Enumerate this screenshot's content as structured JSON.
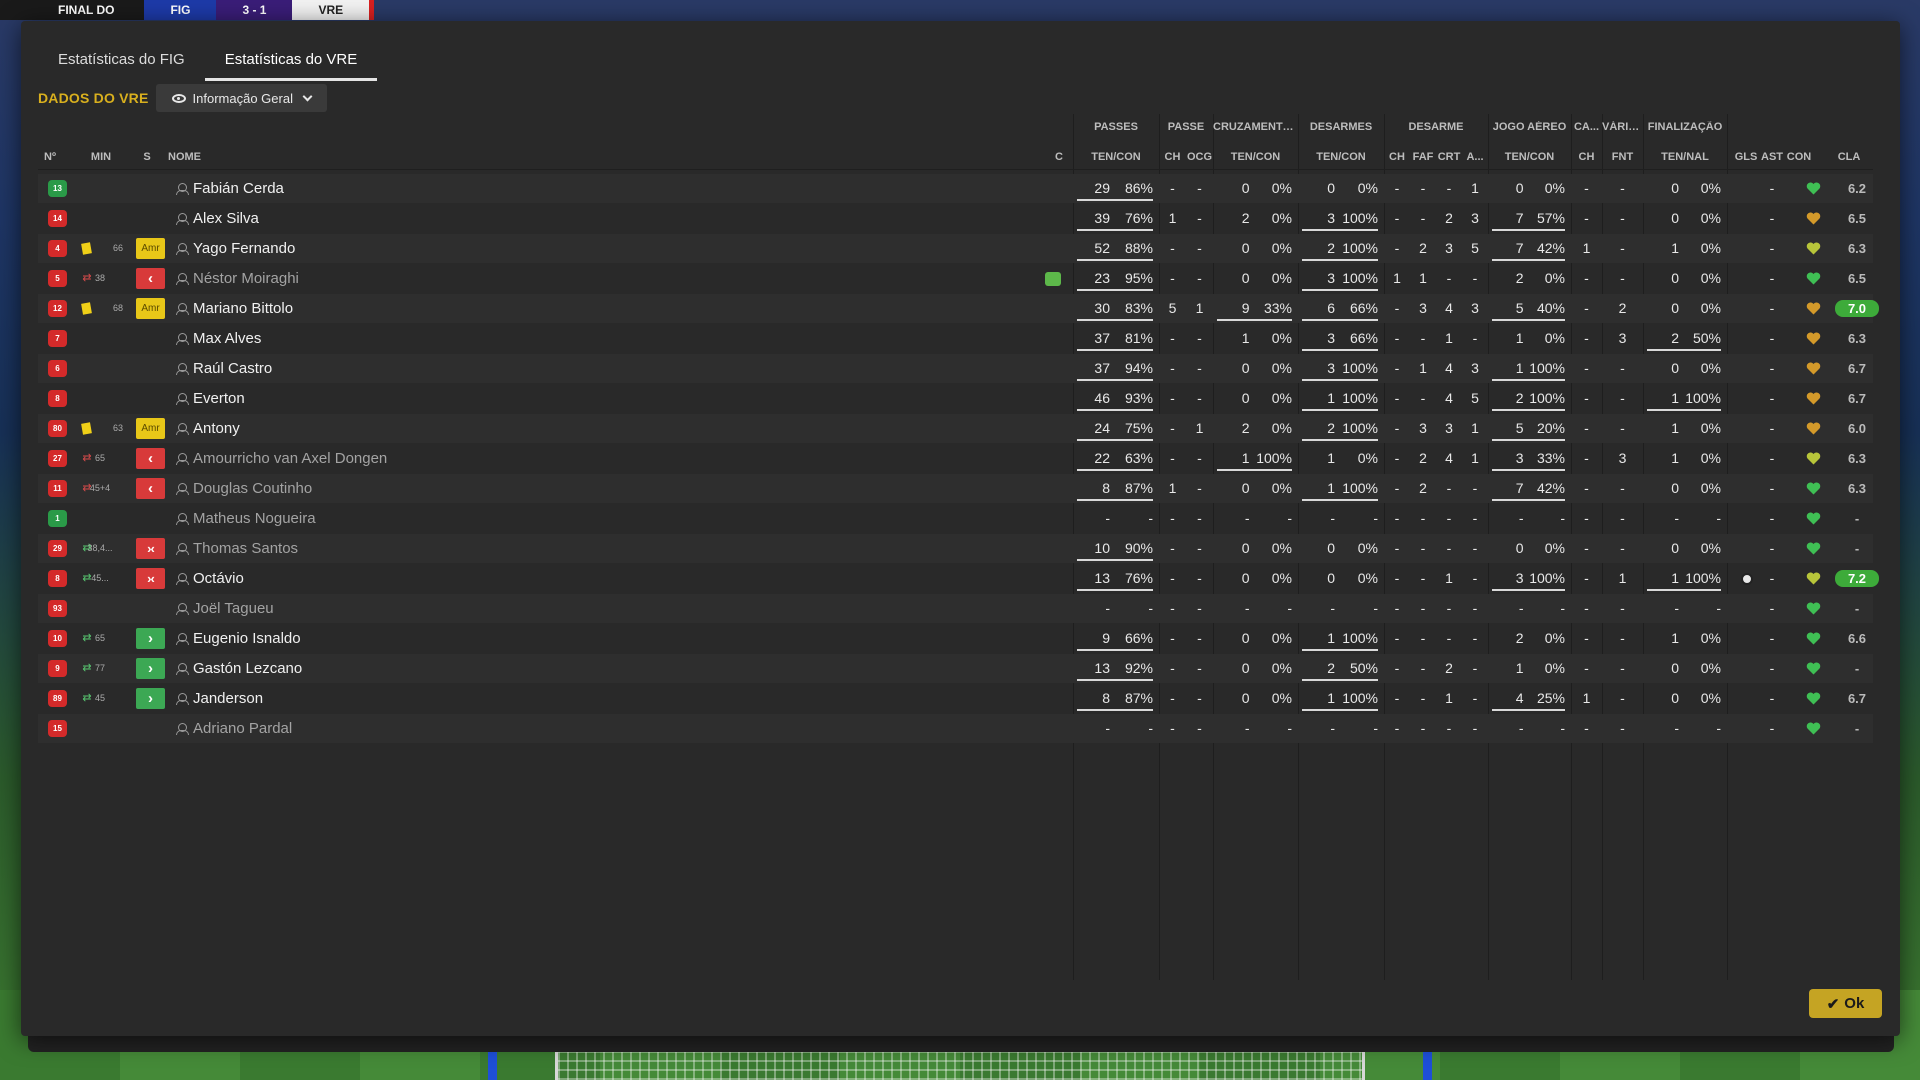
{
  "header": {
    "final_label": "FINAL DO",
    "home_abbr": "FIG",
    "score": "3 - 1",
    "away_abbr": "VRE"
  },
  "tabs": [
    {
      "label": "Estatísticas do FIG",
      "active": false
    },
    {
      "label": "Estatísticas do VRE",
      "active": true
    }
  ],
  "team_title": "DADOS DO VRE",
  "view_dropdown": {
    "selected": "Informação Geral"
  },
  "ok_label": "Ok",
  "colors": {
    "accent": "#d9b01e",
    "ok_button": "#c5a423",
    "card_yellow": "#f0d018",
    "rating_high": "#3dab3a",
    "shirt": "#d42a2a",
    "shirt_gk": "#2a9a48"
  },
  "column_groups": [
    {
      "label": "PASSES"
    },
    {
      "label": "PASSE"
    },
    {
      "label": "CRUZAMENTOS"
    },
    {
      "label": "DESARMES"
    },
    {
      "label": "DESARME"
    },
    {
      "label": "JOGO AÉREO"
    },
    {
      "label": "CA..."
    },
    {
      "label": "VÁRIOS"
    },
    {
      "label": "FINALIZAÇÃO"
    }
  ],
  "columns": {
    "num": "Nº",
    "min": "MIN",
    "s": "S",
    "name": "NOME",
    "c": "C",
    "pass": "TEN/CON",
    "pass_ch": "CH",
    "pass_ocg": "OCG",
    "cross": "TEN/CON",
    "tackles": "TEN/CON",
    "des_ch": "CH",
    "des_faf": "FAF",
    "des_crt": "CRT",
    "des_a": "A...",
    "aerial": "TEN/CON",
    "ca_ch": "CH",
    "fnt": "FNT",
    "fin": "TEN/NAL",
    "gls": "GLS",
    "ast": "AST",
    "con": "CON",
    "cla": "CLA"
  },
  "players": [
    {
      "num": "13",
      "gk": true,
      "card": false,
      "sub": "",
      "min": "",
      "status": "",
      "name": "Fabián Cerda",
      "dim": false,
      "inj": false,
      "pass": [
        "29",
        "86%"
      ],
      "pass_ul": true,
      "pch": "-",
      "pocg": "-",
      "cross": [
        "0",
        "0%"
      ],
      "cross_ul": false,
      "tack": [
        "0",
        "0%"
      ],
      "tack_ul": false,
      "dch": "-",
      "faf": "-",
      "crt": "-",
      "da": "1",
      "aer": [
        "0",
        "0%"
      ],
      "aer_ul": false,
      "cach": "-",
      "fnt": "-",
      "fin": [
        "0",
        "0%"
      ],
      "fin_ul": false,
      "goal": false,
      "gls": "",
      "ast": "-",
      "con": "green",
      "cla": "6.2",
      "cla_hl": false
    },
    {
      "num": "14",
      "gk": false,
      "card": false,
      "sub": "",
      "min": "",
      "status": "",
      "name": "Alex Silva",
      "dim": false,
      "inj": false,
      "pass": [
        "39",
        "76%"
      ],
      "pass_ul": true,
      "pch": "1",
      "pocg": "-",
      "cross": [
        "2",
        "0%"
      ],
      "cross_ul": false,
      "tack": [
        "3",
        "100%"
      ],
      "tack_ul": true,
      "dch": "-",
      "faf": "-",
      "crt": "2",
      "da": "3",
      "aer": [
        "7",
        "57%"
      ],
      "aer_ul": true,
      "cach": "-",
      "fnt": "-",
      "fin": [
        "0",
        "0%"
      ],
      "fin_ul": false,
      "goal": false,
      "gls": "",
      "ast": "-",
      "con": "orange",
      "cla": "6.5",
      "cla_hl": false
    },
    {
      "num": "4",
      "gk": false,
      "card": true,
      "sub": "",
      "min": "66",
      "status": "amr",
      "name": "Yago Fernando",
      "dim": false,
      "inj": false,
      "pass": [
        "52",
        "88%"
      ],
      "pass_ul": true,
      "pch": "-",
      "pocg": "-",
      "cross": [
        "0",
        "0%"
      ],
      "cross_ul": false,
      "tack": [
        "2",
        "100%"
      ],
      "tack_ul": true,
      "dch": "-",
      "faf": "2",
      "crt": "3",
      "da": "5",
      "aer": [
        "7",
        "42%"
      ],
      "aer_ul": true,
      "cach": "1",
      "fnt": "-",
      "fin": [
        "1",
        "0%"
      ],
      "fin_ul": false,
      "goal": false,
      "gls": "",
      "ast": "-",
      "con": "yellow",
      "cla": "6.3",
      "cla_hl": false
    },
    {
      "num": "5",
      "gk": false,
      "card": false,
      "sub": "out",
      "min": "38",
      "status": "out",
      "name": "Néstor Moiraghi",
      "dim": true,
      "inj": true,
      "pass": [
        "23",
        "95%"
      ],
      "pass_ul": true,
      "pch": "-",
      "pocg": "-",
      "cross": [
        "0",
        "0%"
      ],
      "cross_ul": false,
      "tack": [
        "3",
        "100%"
      ],
      "tack_ul": true,
      "dch": "1",
      "faf": "1",
      "crt": "-",
      "da": "-",
      "aer": [
        "2",
        "0%"
      ],
      "aer_ul": false,
      "cach": "-",
      "fnt": "-",
      "fin": [
        "0",
        "0%"
      ],
      "fin_ul": false,
      "goal": false,
      "gls": "",
      "ast": "-",
      "con": "green",
      "cla": "6.5",
      "cla_hl": false
    },
    {
      "num": "12",
      "gk": false,
      "card": true,
      "sub": "",
      "min": "68",
      "status": "amr",
      "name": "Mariano Bittolo",
      "dim": false,
      "inj": false,
      "pass": [
        "30",
        "83%"
      ],
      "pass_ul": true,
      "pch": "5",
      "pocg": "1",
      "cross": [
        "9",
        "33%"
      ],
      "cross_ul": true,
      "tack": [
        "6",
        "66%"
      ],
      "tack_ul": true,
      "dch": "-",
      "faf": "3",
      "crt": "4",
      "da": "3",
      "aer": [
        "5",
        "40%"
      ],
      "aer_ul": true,
      "cach": "-",
      "fnt": "2",
      "fin": [
        "0",
        "0%"
      ],
      "fin_ul": false,
      "goal": false,
      "gls": "",
      "ast": "-",
      "con": "orange",
      "cla": "7.0",
      "cla_hl": true
    },
    {
      "num": "7",
      "gk": false,
      "card": false,
      "sub": "",
      "min": "",
      "status": "",
      "name": "Max Alves",
      "dim": false,
      "inj": false,
      "pass": [
        "37",
        "81%"
      ],
      "pass_ul": true,
      "pch": "-",
      "pocg": "-",
      "cross": [
        "1",
        "0%"
      ],
      "cross_ul": false,
      "tack": [
        "3",
        "66%"
      ],
      "tack_ul": true,
      "dch": "-",
      "faf": "-",
      "crt": "1",
      "da": "-",
      "aer": [
        "1",
        "0%"
      ],
      "aer_ul": false,
      "cach": "-",
      "fnt": "3",
      "fin": [
        "2",
        "50%"
      ],
      "fin_ul": true,
      "goal": false,
      "gls": "",
      "ast": "-",
      "con": "orange",
      "cla": "6.3",
      "cla_hl": false
    },
    {
      "num": "6",
      "gk": false,
      "card": false,
      "sub": "",
      "min": "",
      "status": "",
      "name": "Raúl Castro",
      "dim": false,
      "inj": false,
      "pass": [
        "37",
        "94%"
      ],
      "pass_ul": true,
      "pch": "-",
      "pocg": "-",
      "cross": [
        "0",
        "0%"
      ],
      "cross_ul": false,
      "tack": [
        "3",
        "100%"
      ],
      "tack_ul": true,
      "dch": "-",
      "faf": "1",
      "crt": "4",
      "da": "3",
      "aer": [
        "1",
        "100%"
      ],
      "aer_ul": true,
      "cach": "-",
      "fnt": "-",
      "fin": [
        "0",
        "0%"
      ],
      "fin_ul": false,
      "goal": false,
      "gls": "",
      "ast": "-",
      "con": "orange",
      "cla": "6.7",
      "cla_hl": false
    },
    {
      "num": "8",
      "gk": false,
      "card": false,
      "sub": "",
      "min": "",
      "status": "",
      "name": "Everton",
      "dim": false,
      "inj": false,
      "pass": [
        "46",
        "93%"
      ],
      "pass_ul": true,
      "pch": "-",
      "pocg": "-",
      "cross": [
        "0",
        "0%"
      ],
      "cross_ul": false,
      "tack": [
        "1",
        "100%"
      ],
      "tack_ul": true,
      "dch": "-",
      "faf": "-",
      "crt": "4",
      "da": "5",
      "aer": [
        "2",
        "100%"
      ],
      "aer_ul": true,
      "cach": "-",
      "fnt": "-",
      "fin": [
        "1",
        "100%"
      ],
      "fin_ul": true,
      "goal": false,
      "gls": "",
      "ast": "-",
      "con": "orange",
      "cla": "6.7",
      "cla_hl": false
    },
    {
      "num": "80",
      "gk": false,
      "card": true,
      "sub": "",
      "min": "63",
      "status": "amr",
      "name": "Antony",
      "dim": false,
      "inj": false,
      "pass": [
        "24",
        "75%"
      ],
      "pass_ul": true,
      "pch": "-",
      "pocg": "1",
      "cross": [
        "2",
        "0%"
      ],
      "cross_ul": false,
      "tack": [
        "2",
        "100%"
      ],
      "tack_ul": true,
      "dch": "-",
      "faf": "3",
      "crt": "3",
      "da": "1",
      "aer": [
        "5",
        "20%"
      ],
      "aer_ul": true,
      "cach": "-",
      "fnt": "-",
      "fin": [
        "1",
        "0%"
      ],
      "fin_ul": false,
      "goal": false,
      "gls": "",
      "ast": "-",
      "con": "orange",
      "cla": "6.0",
      "cla_hl": false
    },
    {
      "num": "27",
      "gk": false,
      "card": false,
      "sub": "out",
      "min": "65",
      "status": "out",
      "name": "Amourricho van Axel Dongen",
      "dim": true,
      "inj": false,
      "pass": [
        "22",
        "63%"
      ],
      "pass_ul": true,
      "pch": "-",
      "pocg": "-",
      "cross": [
        "1",
        "100%"
      ],
      "cross_ul": true,
      "tack": [
        "1",
        "0%"
      ],
      "tack_ul": false,
      "dch": "-",
      "faf": "2",
      "crt": "4",
      "da": "1",
      "aer": [
        "3",
        "33%"
      ],
      "aer_ul": true,
      "cach": "-",
      "fnt": "3",
      "fin": [
        "1",
        "0%"
      ],
      "fin_ul": false,
      "goal": false,
      "gls": "",
      "ast": "-",
      "con": "yellow",
      "cla": "6.3",
      "cla_hl": false
    },
    {
      "num": "11",
      "gk": false,
      "card": false,
      "sub": "out",
      "min": "45+4",
      "status": "out",
      "name": "Douglas Coutinho",
      "dim": true,
      "inj": false,
      "pass": [
        "8",
        "87%"
      ],
      "pass_ul": true,
      "pch": "1",
      "pocg": "-",
      "cross": [
        "0",
        "0%"
      ],
      "cross_ul": false,
      "tack": [
        "1",
        "100%"
      ],
      "tack_ul": true,
      "dch": "-",
      "faf": "2",
      "crt": "-",
      "da": "-",
      "aer": [
        "7",
        "42%"
      ],
      "aer_ul": true,
      "cach": "-",
      "fnt": "-",
      "fin": [
        "0",
        "0%"
      ],
      "fin_ul": false,
      "goal": false,
      "gls": "",
      "ast": "-",
      "con": "green",
      "cla": "6.3",
      "cla_hl": false
    },
    {
      "num": "1",
      "gk": true,
      "card": false,
      "sub": "",
      "min": "",
      "status": "",
      "name": "Matheus Nogueira",
      "dim": true,
      "inj": false,
      "pass": [
        "-",
        "-"
      ],
      "pass_ul": false,
      "pch": "-",
      "pocg": "-",
      "cross": [
        "-",
        "-"
      ],
      "cross_ul": false,
      "tack": [
        "-",
        "-"
      ],
      "tack_ul": false,
      "dch": "-",
      "faf": "-",
      "crt": "-",
      "da": "-",
      "aer": [
        "-",
        "-"
      ],
      "aer_ul": false,
      "cach": "-",
      "fnt": "-",
      "fin": [
        "-",
        "-"
      ],
      "fin_ul": false,
      "goal": false,
      "gls": "",
      "ast": "-",
      "con": "green",
      "cla": "-",
      "cla_hl": false
    },
    {
      "num": "29",
      "gk": false,
      "card": false,
      "sub": "in",
      "min": "38,4...",
      "status": "inout",
      "name": "Thomas Santos",
      "dim": true,
      "inj": false,
      "pass": [
        "10",
        "90%"
      ],
      "pass_ul": true,
      "pch": "-",
      "pocg": "-",
      "cross": [
        "0",
        "0%"
      ],
      "cross_ul": false,
      "tack": [
        "0",
        "0%"
      ],
      "tack_ul": false,
      "dch": "-",
      "faf": "-",
      "crt": "-",
      "da": "-",
      "aer": [
        "0",
        "0%"
      ],
      "aer_ul": false,
      "cach": "-",
      "fnt": "-",
      "fin": [
        "0",
        "0%"
      ],
      "fin_ul": false,
      "goal": false,
      "gls": "",
      "ast": "-",
      "con": "green",
      "cla": "-",
      "cla_hl": false
    },
    {
      "num": "8",
      "gk": false,
      "card": false,
      "sub": "in",
      "min": "45...",
      "status": "inout",
      "name": "Octávio",
      "dim": false,
      "inj": false,
      "pass": [
        "13",
        "76%"
      ],
      "pass_ul": true,
      "pch": "-",
      "pocg": "-",
      "cross": [
        "0",
        "0%"
      ],
      "cross_ul": false,
      "tack": [
        "0",
        "0%"
      ],
      "tack_ul": false,
      "dch": "-",
      "faf": "-",
      "crt": "1",
      "da": "-",
      "aer": [
        "3",
        "100%"
      ],
      "aer_ul": true,
      "cach": "-",
      "fnt": "1",
      "fin": [
        "1",
        "100%"
      ],
      "fin_ul": true,
      "goal": true,
      "gls": "",
      "ast": "-",
      "con": "yellow",
      "cla": "7.2",
      "cla_hl": true
    },
    {
      "num": "93",
      "gk": false,
      "card": false,
      "sub": "",
      "min": "",
      "status": "",
      "name": "Joël Tagueu",
      "dim": true,
      "inj": false,
      "pass": [
        "-",
        "-"
      ],
      "pass_ul": false,
      "pch": "-",
      "pocg": "-",
      "cross": [
        "-",
        "-"
      ],
      "cross_ul": false,
      "tack": [
        "-",
        "-"
      ],
      "tack_ul": false,
      "dch": "-",
      "faf": "-",
      "crt": "-",
      "da": "-",
      "aer": [
        "-",
        "-"
      ],
      "aer_ul": false,
      "cach": "-",
      "fnt": "-",
      "fin": [
        "-",
        "-"
      ],
      "fin_ul": false,
      "goal": false,
      "gls": "",
      "ast": "-",
      "con": "green",
      "cla": "-",
      "cla_hl": false
    },
    {
      "num": "10",
      "gk": false,
      "card": false,
      "sub": "in",
      "min": "65",
      "status": "in",
      "name": "Eugenio Isnaldo",
      "dim": false,
      "inj": false,
      "pass": [
        "9",
        "66%"
      ],
      "pass_ul": true,
      "pch": "-",
      "pocg": "-",
      "cross": [
        "0",
        "0%"
      ],
      "cross_ul": false,
      "tack": [
        "1",
        "100%"
      ],
      "tack_ul": true,
      "dch": "-",
      "faf": "-",
      "crt": "-",
      "da": "-",
      "aer": [
        "2",
        "0%"
      ],
      "aer_ul": false,
      "cach": "-",
      "fnt": "-",
      "fin": [
        "1",
        "0%"
      ],
      "fin_ul": false,
      "goal": false,
      "gls": "",
      "ast": "-",
      "con": "green",
      "cla": "6.6",
      "cla_hl": false
    },
    {
      "num": "9",
      "gk": false,
      "card": false,
      "sub": "in",
      "min": "77",
      "status": "in",
      "name": "Gastón Lezcano",
      "dim": false,
      "inj": false,
      "pass": [
        "13",
        "92%"
      ],
      "pass_ul": true,
      "pch": "-",
      "pocg": "-",
      "cross": [
        "0",
        "0%"
      ],
      "cross_ul": false,
      "tack": [
        "2",
        "50%"
      ],
      "tack_ul": true,
      "dch": "-",
      "faf": "-",
      "crt": "2",
      "da": "-",
      "aer": [
        "1",
        "0%"
      ],
      "aer_ul": false,
      "cach": "-",
      "fnt": "-",
      "fin": [
        "0",
        "0%"
      ],
      "fin_ul": false,
      "goal": false,
      "gls": "",
      "ast": "-",
      "con": "green",
      "cla": "-",
      "cla_hl": false
    },
    {
      "num": "89",
      "gk": false,
      "card": false,
      "sub": "in",
      "min": "45",
      "status": "in",
      "name": "Janderson",
      "dim": false,
      "inj": false,
      "pass": [
        "8",
        "87%"
      ],
      "pass_ul": true,
      "pch": "-",
      "pocg": "-",
      "cross": [
        "0",
        "0%"
      ],
      "cross_ul": false,
      "tack": [
        "1",
        "100%"
      ],
      "tack_ul": true,
      "dch": "-",
      "faf": "-",
      "crt": "1",
      "da": "-",
      "aer": [
        "4",
        "25%"
      ],
      "aer_ul": true,
      "cach": "1",
      "fnt": "-",
      "fin": [
        "0",
        "0%"
      ],
      "fin_ul": false,
      "goal": false,
      "gls": "",
      "ast": "-",
      "con": "green",
      "cla": "6.7",
      "cla_hl": false
    },
    {
      "num": "15",
      "gk": false,
      "card": false,
      "sub": "",
      "min": "",
      "status": "",
      "name": "Adriano Pardal",
      "dim": true,
      "inj": false,
      "pass": [
        "-",
        "-"
      ],
      "pass_ul": false,
      "pch": "-",
      "pocg": "-",
      "cross": [
        "-",
        "-"
      ],
      "cross_ul": false,
      "tack": [
        "-",
        "-"
      ],
      "tack_ul": false,
      "dch": "-",
      "faf": "-",
      "crt": "-",
      "da": "-",
      "aer": [
        "-",
        "-"
      ],
      "aer_ul": false,
      "cach": "-",
      "fnt": "-",
      "fin": [
        "-",
        "-"
      ],
      "fin_ul": false,
      "goal": false,
      "gls": "",
      "ast": "-",
      "con": "green",
      "cla": "-",
      "cla_hl": false
    }
  ]
}
